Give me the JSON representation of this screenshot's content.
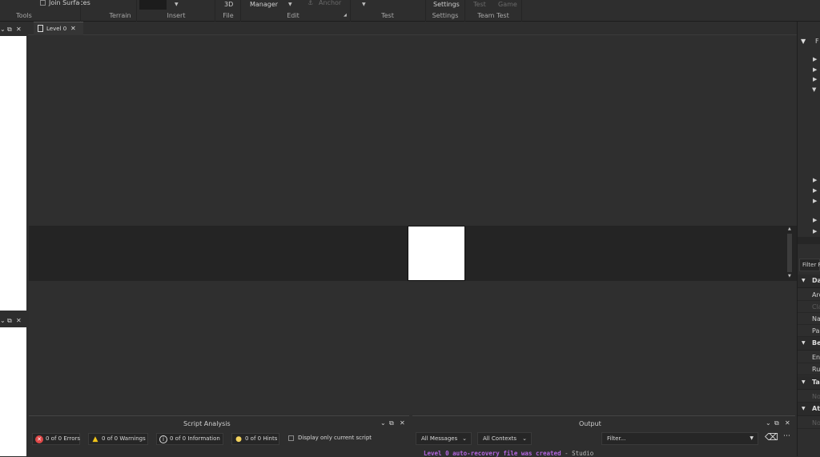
{
  "ribbon": {
    "join_surfaces": "Join Surfaces",
    "manager": "Manager",
    "anchor": "Anchor",
    "three_d": "3D",
    "settings": "Settings",
    "test_btn": "Test",
    "game_btn": "Game",
    "groups": {
      "tools": "Tools",
      "terrain": "Terrain",
      "insert": "Insert",
      "file": "File",
      "edit": "Edit",
      "test": "Test",
      "settings": "Settings",
      "team_test": "Team Test"
    }
  },
  "tabs": [
    {
      "label": "Level 0"
    }
  ],
  "right_panel": {
    "filter_placeholder": "Filter F",
    "sections": [
      {
        "label": "Da",
        "rows": [
          "Arc",
          "Cla",
          "Na",
          "Pa"
        ]
      },
      {
        "label": "Be",
        "rows": [
          "En",
          "Ru"
        ]
      },
      {
        "label": "Ta",
        "rows": [
          "No"
        ]
      },
      {
        "label": "Att",
        "rows": [
          "No"
        ]
      }
    ],
    "top_label": "F"
  },
  "script_analysis": {
    "title": "Script Analysis",
    "errors": "0 of 0 Errors",
    "warnings": "0 of 0 Warnings",
    "information": "0 of 0 Information",
    "hints": "0 of 0 Hints",
    "display_only_current": "Display only current script"
  },
  "output": {
    "title": "Output",
    "messages_filter": "All Messages",
    "contexts_filter": "All Contexts",
    "filter_placeholder": "Filter...",
    "messages": [
      {
        "text": "Level 0 auto-recovery file was created",
        "separator": "-",
        "source": "Studio"
      }
    ]
  },
  "colors": {
    "message_text": "#b566e0",
    "error_icon": "#e04848",
    "warning_icon": "#f0c419",
    "hint_icon": "#f4d35e"
  }
}
